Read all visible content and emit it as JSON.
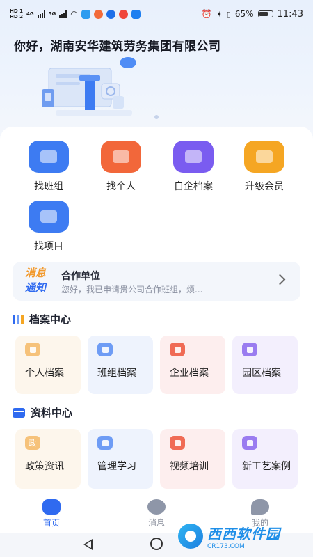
{
  "status_bar": {
    "left_labels": [
      "HD 1",
      "HD 2",
      "4G",
      "5G"
    ],
    "battery": "65%",
    "time": "11:43"
  },
  "banner": {
    "greeting": "你好，湖南安华建筑劳务集团有限公司"
  },
  "quick_actions": [
    {
      "label": "找班组",
      "icon": "team-icon",
      "color": "#3d7bf2"
    },
    {
      "label": "找个人",
      "icon": "person-card-icon",
      "color": "#f2673a"
    },
    {
      "label": "自企档案",
      "icon": "company-archive-icon",
      "color": "#7a5cf0"
    },
    {
      "label": "升级会员",
      "icon": "vip-upgrade-icon",
      "color": "#f5a623"
    },
    {
      "label": "找项目",
      "icon": "project-icon",
      "color": "#3d7bf2"
    }
  ],
  "notice": {
    "tag_line1": "消息",
    "tag_line2": "通知",
    "title": "合作单位",
    "text": "您好，我已申请贵公司合作班组，烦..."
  },
  "archive_center": {
    "title": "档案中心",
    "tiles": [
      {
        "label": "个人档案",
        "bg": "#fdf6ec",
        "icon_color": "#f6c27a"
      },
      {
        "label": "班组档案",
        "bg": "#eef3fd",
        "icon_color": "#6e9cf5"
      },
      {
        "label": "企业档案",
        "bg": "#fdeeee",
        "icon_color": "#f06b55"
      },
      {
        "label": "园区档案",
        "bg": "#f3effd",
        "icon_color": "#9a7cf0"
      }
    ]
  },
  "data_center": {
    "title": "资料中心",
    "tiles": [
      {
        "label": "政策资讯",
        "bg": "#fdf6ec",
        "icon_color": "#f6c27a",
        "glyph": "政"
      },
      {
        "label": "管理学习",
        "bg": "#eef3fd",
        "icon_color": "#6e9cf5",
        "glyph": ""
      },
      {
        "label": "视频培训",
        "bg": "#fdeeee",
        "icon_color": "#f06b55",
        "glyph": ""
      },
      {
        "label": "新工艺案例",
        "bg": "#f3effd",
        "icon_color": "#9a7cf0",
        "glyph": ""
      }
    ]
  },
  "tabbar": {
    "home": "首页",
    "messages": "消息",
    "mine": "我的"
  },
  "watermark": {
    "main": "西西软件园",
    "sub": "CR173.COM"
  }
}
